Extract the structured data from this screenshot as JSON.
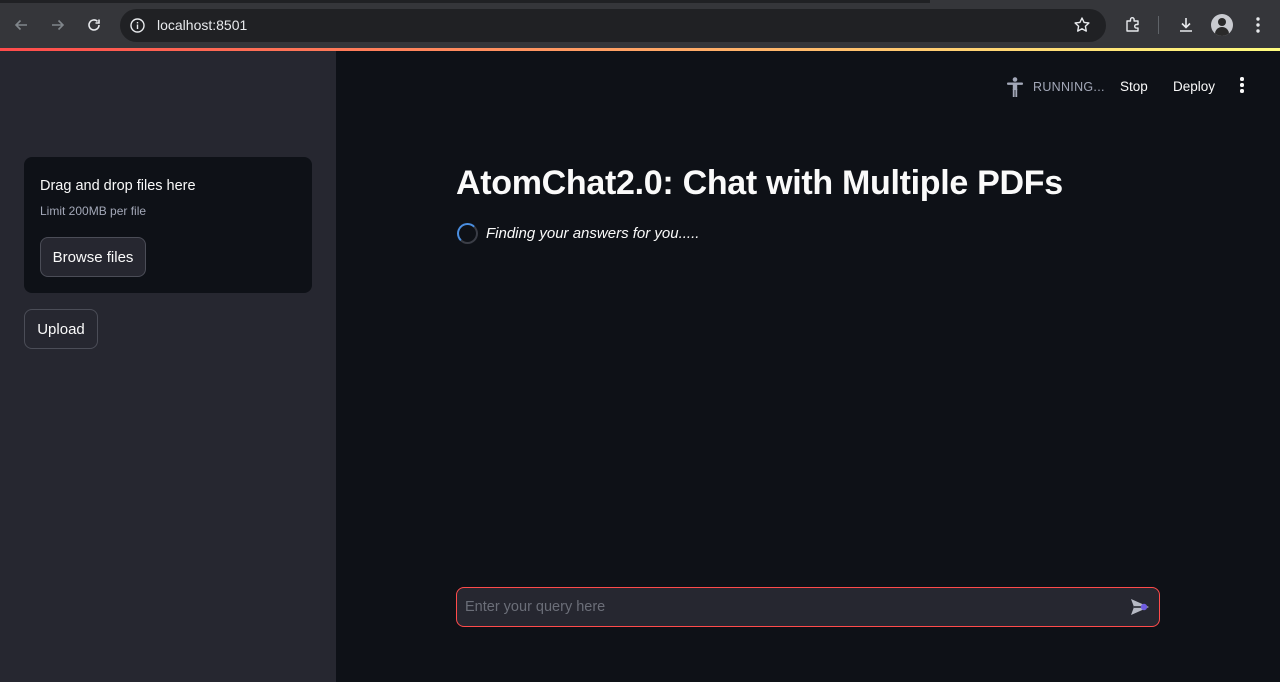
{
  "browser": {
    "url": "localhost:8501"
  },
  "sidebar": {
    "uploader_title": "Drag and drop files here",
    "uploader_limit": "Limit 200MB per file",
    "browse_label": "Browse files",
    "upload_label": "Upload"
  },
  "header": {
    "status": "RUNNING...",
    "stop_label": "Stop",
    "deploy_label": "Deploy"
  },
  "main": {
    "title": "AtomChat2.0: Chat with Multiple PDFs",
    "spinner_text": "Finding your answers for you.....",
    "chat_placeholder": "Enter your query here",
    "chat_value": ""
  },
  "colors": {
    "accent": "#ff4b4b",
    "background": "#0e1117",
    "sidebar": "#262730",
    "text": "#fafafa"
  },
  "icons": [
    "back-arrow-icon",
    "forward-arrow-icon",
    "reload-icon",
    "info-icon",
    "star-icon",
    "extensions-icon",
    "download-icon",
    "profile-avatar",
    "chrome-menu-icon",
    "running-man-icon",
    "kebab-menu-icon",
    "spinner-icon",
    "send-icon"
  ]
}
